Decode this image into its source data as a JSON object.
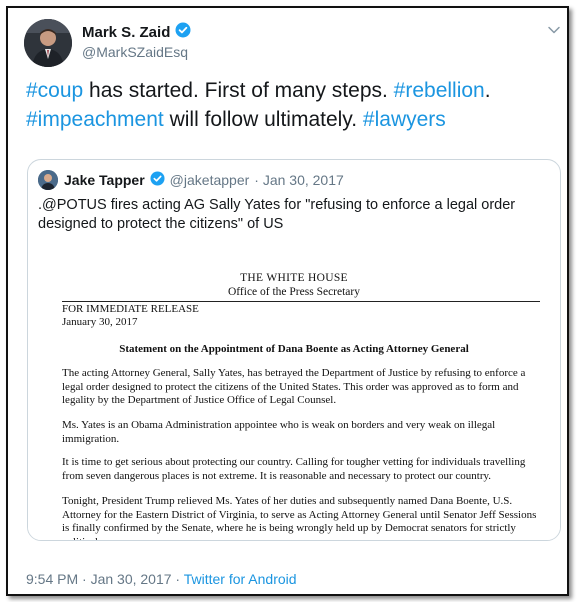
{
  "tweet": {
    "author_name": "Mark S. Zaid",
    "author_handle": "@MarkSZaidEsq",
    "body": {
      "tag1": "#coup",
      "text1": " has started. First of many steps. ",
      "tag2": "#rebellion",
      "text2": ".",
      "tag3": "#impeachment",
      "text3": " will follow ultimately. ",
      "tag4": "#lawyers"
    },
    "footer": {
      "time": "9:54 PM · Jan 30, 2017 · ",
      "source": "Twitter for Android"
    }
  },
  "quoted_tweet": {
    "author_name": "Jake Tapper",
    "author_handle": "@jaketapper",
    "date": "· Jan 30, 2017",
    "text": ".@POTUS fires acting AG Sally Yates  for \"refusing to enforce a legal order designed to protect the citizens\" of US",
    "document": {
      "header": "THE WHITE HOUSE",
      "office": "Office of the Press Secretary",
      "release": "FOR IMMEDIATE RELEASE",
      "date": "January 30, 2017",
      "statement_title": "Statement on the Appointment of Dana Boente as Acting Attorney General",
      "p1": "The acting Attorney General, Sally Yates, has betrayed the Department of Justice by refusing to enforce a legal order designed to protect the citizens of the United States. This order was approved as to form and legality by the Department of Justice Office of Legal Counsel.",
      "p2": "Ms. Yates is an Obama Administration appointee who is weak on borders and very weak on illegal immigration.",
      "p3": "It is time to get serious about protecting our country. Calling for tougher vetting for individuals travelling from seven dangerous places is not extreme. It is reasonable and necessary to protect our country.",
      "p4": "Tonight, President Trump relieved Ms. Yates of her duties and subsequently named Dana Boente, U.S. Attorney for the Eastern District of Virginia, to serve as Acting Attorney General until Senator Jeff Sessions is finally confirmed by the Senate, where he is being wrongly held up by Democrat senators for strictly political reasons."
    }
  },
  "colors": {
    "link": "#1b95e0",
    "verified": "#1da1f2",
    "muted": "#657786"
  }
}
